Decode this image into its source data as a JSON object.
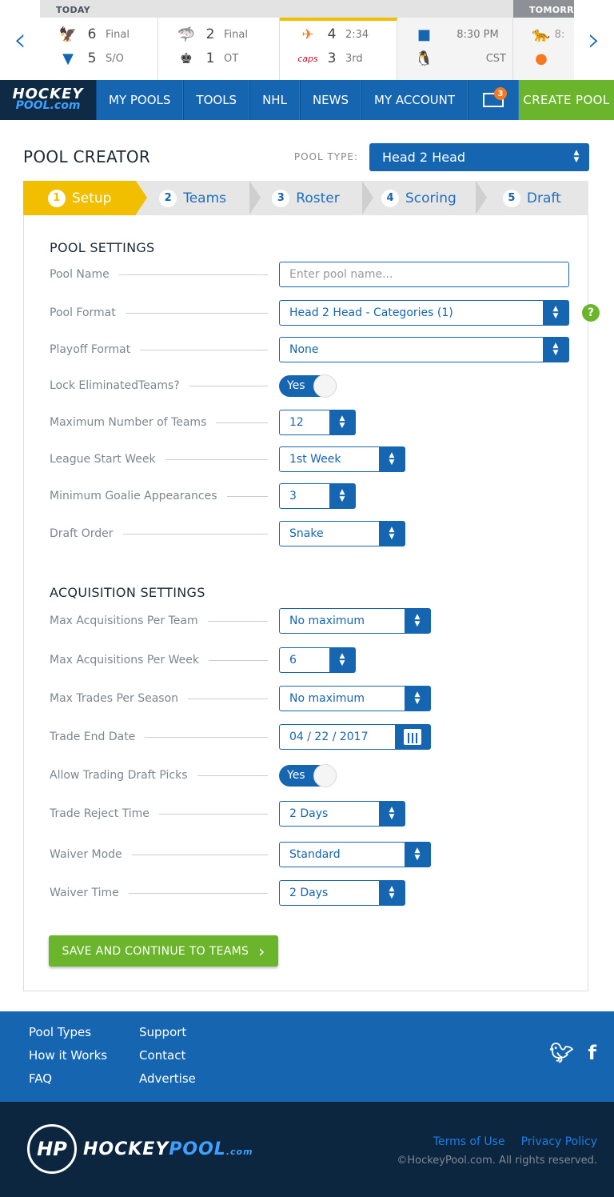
{
  "scores": {
    "today_label": "TODAY",
    "tomorrow_label": "TOMORRO",
    "games": [
      {
        "home_score": "6",
        "home_status": "Final",
        "away_score": "5",
        "away_status": "S/O",
        "home_icon": "blackhawks-logo-icon",
        "away_icon": "blues-logo-icon"
      },
      {
        "home_score": "2",
        "home_status": "Final",
        "away_score": "1",
        "away_status": "OT",
        "home_icon": "sharks-logo-icon",
        "away_icon": "kings-logo-icon"
      },
      {
        "home_score": "4",
        "home_status": "2:34",
        "away_score": "3",
        "away_status": "3rd",
        "home_icon": "flyers-logo-icon",
        "away_icon": "capitals-logo-icon"
      },
      {
        "home_score": "",
        "home_status": "8:30 PM",
        "away_score": "",
        "away_status": "CST",
        "home_icon": "rangers-logo-icon",
        "away_icon": "penguins-logo-icon"
      },
      {
        "home_score": "",
        "home_status": "8:",
        "away_score": "",
        "away_status": "",
        "home_icon": "panthers-logo-icon",
        "away_icon": "islanders-logo-icon"
      }
    ]
  },
  "nav": {
    "brand_top": "HOCKEY",
    "brand_bottom": "POOL.com",
    "items": [
      "MY POOLS",
      "TOOLS",
      "NHL",
      "NEWS",
      "MY ACCOUNT"
    ],
    "mail_badge": "3",
    "create": "CREATE  POOL"
  },
  "creator": {
    "title": "POOL CREATOR",
    "pool_type_label": "POOL  TYPE:",
    "pool_type_value": "Head 2 Head"
  },
  "steps": [
    {
      "num": "1",
      "label": "Setup"
    },
    {
      "num": "2",
      "label": "Teams"
    },
    {
      "num": "3",
      "label": "Roster"
    },
    {
      "num": "4",
      "label": "Scoring"
    },
    {
      "num": "5",
      "label": "Draft"
    }
  ],
  "pool_settings": {
    "title": "POOL SETTINGS",
    "pool_name_label": "Pool Name",
    "pool_name_placeholder": "Enter pool name...",
    "pool_format_label": "Pool Format",
    "pool_format_value": "Head 2 Head - Categories (1)",
    "playoff_format_label": "Playoff Format",
    "playoff_format_value": "None",
    "lock_label": "Lock EliminatedTeams?",
    "lock_value": "Yes",
    "max_teams_label": "Maximum Number of Teams",
    "max_teams_value": "12",
    "start_week_label": "League Start Week",
    "start_week_value": "1st Week",
    "goalie_label": "Minimum Goalie Appearances",
    "goalie_value": "3",
    "draft_order_label": "Draft Order",
    "draft_order_value": "Snake"
  },
  "acq_settings": {
    "title": "ACQUISITION SETTINGS",
    "max_acq_team_label": "Max Acquisitions Per Team",
    "max_acq_team_value": "No maximum",
    "max_acq_week_label": "Max Acquisitions Per Week",
    "max_acq_week_value": "6",
    "max_trades_label": "Max Trades Per Season",
    "max_trades_value": "No maximum",
    "trade_end_label": "Trade End Date",
    "trade_end_value": "04 / 22 / 2017",
    "draft_picks_label": "Allow Trading Draft Picks",
    "draft_picks_value": "Yes",
    "reject_label": "Trade Reject Time",
    "reject_value": "2 Days",
    "waiver_mode_label": "Waiver Mode",
    "waiver_mode_value": "Standard",
    "waiver_time_label": "Waiver Time",
    "waiver_time_value": "2 Days"
  },
  "save_label": "SAVE AND CONTINUE TO TEAMS",
  "footer": {
    "col1": [
      "Pool Types",
      "How it Works",
      "FAQ"
    ],
    "col2": [
      "Support",
      "Contact",
      "Advertise"
    ],
    "logo_mark": "HP",
    "logo_hockey": "HOCKEY",
    "logo_pool": "POOL",
    "logo_com": ".com",
    "terms": "Terms of Use",
    "privacy": "Privacy Policy",
    "copyright": "©HockeyPool.com. All rights reserved."
  }
}
